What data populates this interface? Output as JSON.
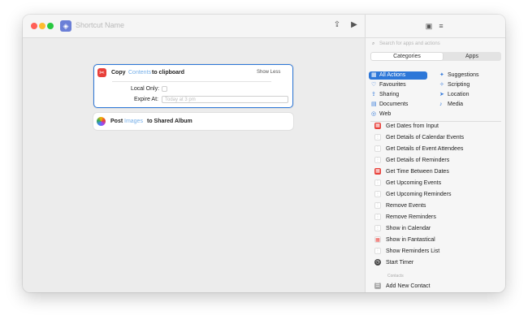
{
  "window": {
    "shortcut_name": "Shortcut Name",
    "toolbar_icons": [
      "share-icon",
      "play-icon"
    ]
  },
  "editor": {
    "copy_action": {
      "verb": "Copy",
      "variable": "Contents",
      "suffix": "to clipboard",
      "toggle_label": "Show Less",
      "local_only_label": "Local Only:",
      "expire_label": "Expire At:",
      "expire_placeholder": "Today at 3 pm"
    },
    "post_action": {
      "verb": "Post",
      "variable": "Images",
      "suffix": "to Shared Album"
    }
  },
  "library": {
    "search_placeholder": "Search for apps and actions",
    "tabs": [
      "Categories",
      "Apps"
    ],
    "active_tab": "Categories",
    "categories": [
      {
        "label": "All Actions",
        "icon": "grid-icon",
        "selected": true
      },
      {
        "label": "Suggestions",
        "icon": "sparkle-icon",
        "selected": false
      },
      {
        "label": "Favourites",
        "icon": "heart-icon",
        "selected": false
      },
      {
        "label": "Scripting",
        "icon": "scripting-icon",
        "selected": false
      },
      {
        "label": "Sharing",
        "icon": "share-icon",
        "selected": false
      },
      {
        "label": "Location",
        "icon": "location-icon",
        "selected": false
      },
      {
        "label": "Documents",
        "icon": "document-icon",
        "selected": false
      },
      {
        "label": "Media",
        "icon": "music-icon",
        "selected": false
      },
      {
        "label": "Web",
        "icon": "compass-icon",
        "selected": false
      }
    ],
    "actions": [
      {
        "label": "Get Dates from Input",
        "icon": "calendar-icon"
      },
      {
        "label": "Get Details of Calendar Events",
        "icon": "reminders-icon"
      },
      {
        "label": "Get Details of Event Attendees",
        "icon": "reminders-icon"
      },
      {
        "label": "Get Details of Reminders",
        "icon": "reminders-icon"
      },
      {
        "label": "Get Time Between Dates",
        "icon": "calendar-icon"
      },
      {
        "label": "Get Upcoming Events",
        "icon": "reminders-icon"
      },
      {
        "label": "Get Upcoming Reminders",
        "icon": "reminders-icon"
      },
      {
        "label": "Remove Events",
        "icon": "reminders-icon"
      },
      {
        "label": "Remove Reminders",
        "icon": "reminders-icon"
      },
      {
        "label": "Show in Calendar",
        "icon": "reminders-icon"
      },
      {
        "label": "Show in Fantastical",
        "icon": "fantastical-icon"
      },
      {
        "label": "Show Reminders List",
        "icon": "reminders-icon"
      },
      {
        "label": "Start Timer",
        "icon": "timer-icon"
      }
    ],
    "section_label": "Contacts",
    "contacts_actions": [
      {
        "label": "Add New Contact",
        "icon": "contact-icon"
      }
    ]
  }
}
